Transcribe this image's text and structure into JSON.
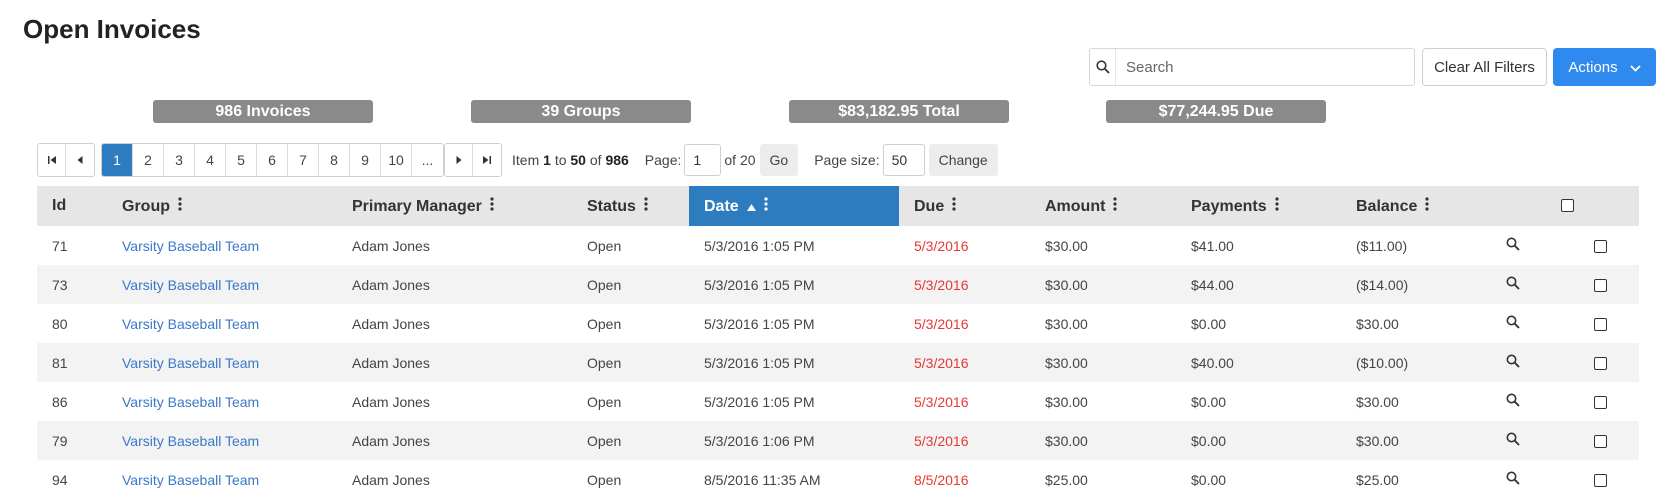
{
  "page": {
    "title": "Open Invoices"
  },
  "toolbar": {
    "search_placeholder": "Search",
    "clear_label": "Clear All Filters",
    "actions_label": "Actions"
  },
  "summary": {
    "invoices": "986 Invoices",
    "groups": "39 Groups",
    "total": "$83,182.95 Total",
    "due": "$77,244.95 Due"
  },
  "pager": {
    "pages": [
      "1",
      "2",
      "3",
      "4",
      "5",
      "6",
      "7",
      "8",
      "9",
      "10",
      "..."
    ],
    "active_page": "1",
    "item_prefix": "Item",
    "item_from": "1",
    "item_to_word": "to",
    "item_to": "50",
    "item_of_word": "of",
    "item_total": "986",
    "page_label": "Page:",
    "page_value": "1",
    "page_of": "of 20",
    "go_label": "Go",
    "page_size_label": "Page size:",
    "page_size_value": "50",
    "change_label": "Change"
  },
  "table": {
    "columns": [
      "Id",
      "Group",
      "Primary Manager",
      "Status",
      "Date",
      "Due",
      "Amount",
      "Payments",
      "Balance"
    ],
    "sorted_column": "Date",
    "rows": [
      {
        "id": "71",
        "group": "Varsity Baseball Team",
        "manager": "Adam Jones",
        "status": "Open",
        "date": "5/3/2016 1:05 PM",
        "due": "5/3/2016",
        "amount": "$30.00",
        "payments": "$41.00",
        "balance": "($11.00)"
      },
      {
        "id": "73",
        "group": "Varsity Baseball Team",
        "manager": "Adam Jones",
        "status": "Open",
        "date": "5/3/2016 1:05 PM",
        "due": "5/3/2016",
        "amount": "$30.00",
        "payments": "$44.00",
        "balance": "($14.00)"
      },
      {
        "id": "80",
        "group": "Varsity Baseball Team",
        "manager": "Adam Jones",
        "status": "Open",
        "date": "5/3/2016 1:05 PM",
        "due": "5/3/2016",
        "amount": "$30.00",
        "payments": "$0.00",
        "balance": "$30.00"
      },
      {
        "id": "81",
        "group": "Varsity Baseball Team",
        "manager": "Adam Jones",
        "status": "Open",
        "date": "5/3/2016 1:05 PM",
        "due": "5/3/2016",
        "amount": "$30.00",
        "payments": "$40.00",
        "balance": "($10.00)"
      },
      {
        "id": "86",
        "group": "Varsity Baseball Team",
        "manager": "Adam Jones",
        "status": "Open",
        "date": "5/3/2016 1:05 PM",
        "due": "5/3/2016",
        "amount": "$30.00",
        "payments": "$0.00",
        "balance": "$30.00"
      },
      {
        "id": "79",
        "group": "Varsity Baseball Team",
        "manager": "Adam Jones",
        "status": "Open",
        "date": "5/3/2016 1:06 PM",
        "due": "5/3/2016",
        "amount": "$30.00",
        "payments": "$0.00",
        "balance": "$30.00"
      },
      {
        "id": "94",
        "group": "Varsity Baseball Team",
        "manager": "Adam Jones",
        "status": "Open",
        "date": "8/5/2016 11:35 AM",
        "due": "8/5/2016",
        "amount": "$25.00",
        "payments": "$0.00",
        "balance": "$25.00"
      }
    ]
  },
  "colors": {
    "accent": "#2f8af0",
    "sorted_header": "#2e7cc0",
    "link": "#3a78c9",
    "due": "#e53935",
    "badge": "#8a8a8a"
  },
  "icons": {
    "search": "search-icon",
    "chevron": "chevron-down-icon",
    "kebab": "kebab-menu-icon",
    "sort": "sort-ascending-icon",
    "view": "magnifier-icon"
  }
}
